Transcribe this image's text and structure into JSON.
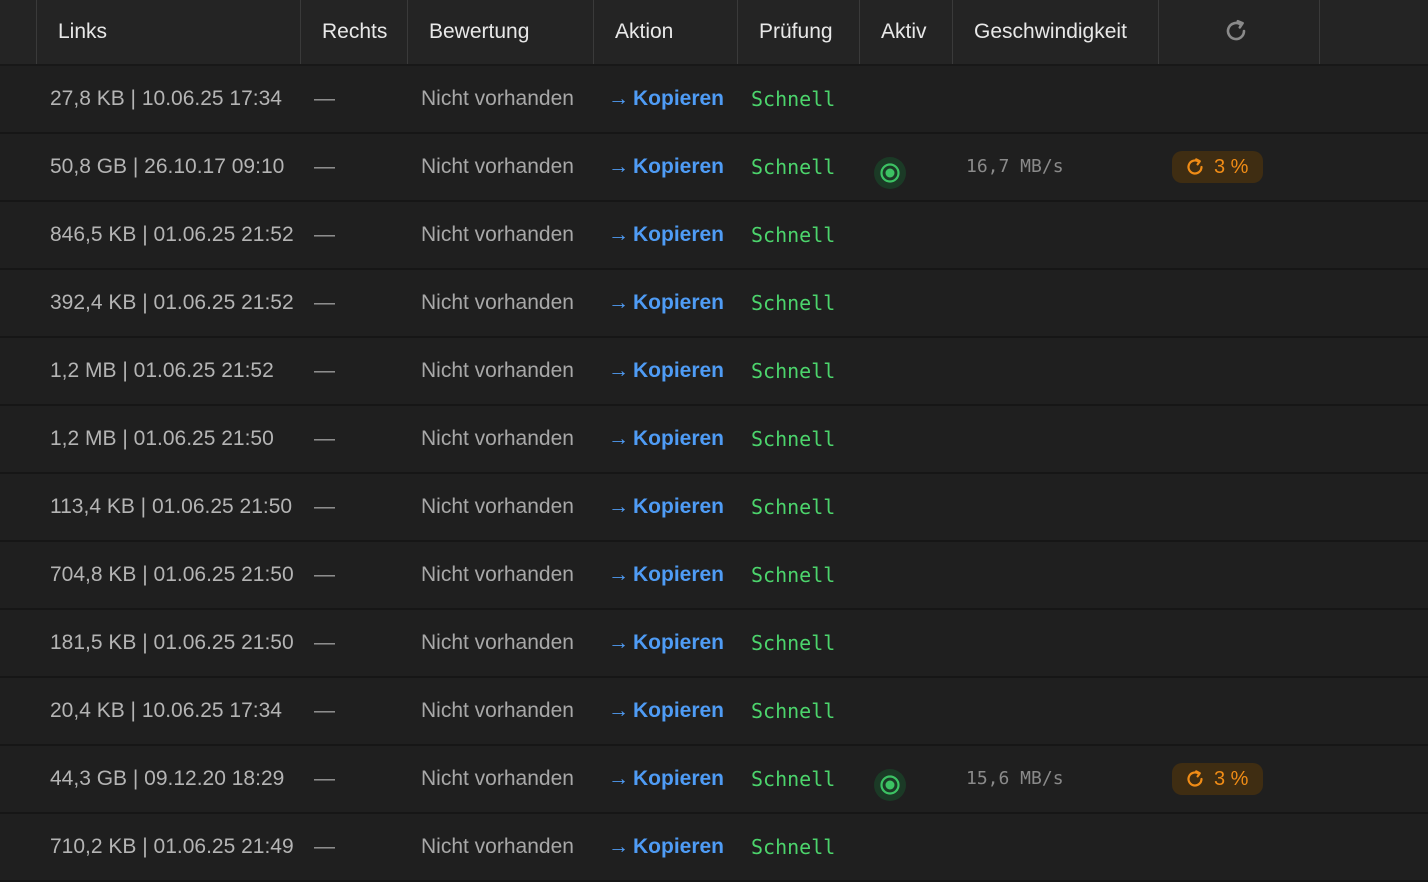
{
  "header": {
    "links": "Links",
    "rechts": "Rechts",
    "bewertung": "Bewertung",
    "aktion": "Aktion",
    "pruefung": "Prüfung",
    "aktiv": "Aktiv",
    "geschwindigkeit": "Geschwindigkeit",
    "refresh_icon": "refresh-icon"
  },
  "colors": {
    "background": "#1f1f1f",
    "header_background": "#242424",
    "action_blue": "#4f9cf5",
    "status_green": "#4cd46c",
    "badge_orange": "#f08c16",
    "badge_background": "#3f2d12"
  },
  "rows": [
    {
      "links": "27,8 KB | 10.06.25 17:34",
      "rechts": "—",
      "bewertung": "Nicht vorhanden",
      "aktion_arrow": "→",
      "aktion": "Kopieren",
      "pruefung": "Schnell",
      "active": false,
      "speed": "",
      "progress": ""
    },
    {
      "links": "50,8 GB | 26.10.17 09:10",
      "rechts": "—",
      "bewertung": "Nicht vorhanden",
      "aktion_arrow": "→",
      "aktion": "Kopieren",
      "pruefung": "Schnell",
      "active": true,
      "speed": "16,7 MB/s",
      "progress": "3 %"
    },
    {
      "links": "846,5 KB | 01.06.25 21:52",
      "rechts": "—",
      "bewertung": "Nicht vorhanden",
      "aktion_arrow": "→",
      "aktion": "Kopieren",
      "pruefung": "Schnell",
      "active": false,
      "speed": "",
      "progress": ""
    },
    {
      "links": "392,4 KB | 01.06.25 21:52",
      "rechts": "—",
      "bewertung": "Nicht vorhanden",
      "aktion_arrow": "→",
      "aktion": "Kopieren",
      "pruefung": "Schnell",
      "active": false,
      "speed": "",
      "progress": ""
    },
    {
      "links": "1,2 MB | 01.06.25 21:52",
      "rechts": "—",
      "bewertung": "Nicht vorhanden",
      "aktion_arrow": "→",
      "aktion": "Kopieren",
      "pruefung": "Schnell",
      "active": false,
      "speed": "",
      "progress": ""
    },
    {
      "links": "1,2 MB | 01.06.25 21:50",
      "rechts": "—",
      "bewertung": "Nicht vorhanden",
      "aktion_arrow": "→",
      "aktion": "Kopieren",
      "pruefung": "Schnell",
      "active": false,
      "speed": "",
      "progress": ""
    },
    {
      "links": "113,4 KB | 01.06.25 21:50",
      "rechts": "—",
      "bewertung": "Nicht vorhanden",
      "aktion_arrow": "→",
      "aktion": "Kopieren",
      "pruefung": "Schnell",
      "active": false,
      "speed": "",
      "progress": ""
    },
    {
      "links": "704,8 KB | 01.06.25 21:50",
      "rechts": "—",
      "bewertung": "Nicht vorhanden",
      "aktion_arrow": "→",
      "aktion": "Kopieren",
      "pruefung": "Schnell",
      "active": false,
      "speed": "",
      "progress": ""
    },
    {
      "links": "181,5 KB | 01.06.25 21:50",
      "rechts": "—",
      "bewertung": "Nicht vorhanden",
      "aktion_arrow": "→",
      "aktion": "Kopieren",
      "pruefung": "Schnell",
      "active": false,
      "speed": "",
      "progress": ""
    },
    {
      "links": "20,4 KB | 10.06.25 17:34",
      "rechts": "—",
      "bewertung": "Nicht vorhanden",
      "aktion_arrow": "→",
      "aktion": "Kopieren",
      "pruefung": "Schnell",
      "active": false,
      "speed": "",
      "progress": ""
    },
    {
      "links": "44,3 GB | 09.12.20 18:29",
      "rechts": "—",
      "bewertung": "Nicht vorhanden",
      "aktion_arrow": "→",
      "aktion": "Kopieren",
      "pruefung": "Schnell",
      "active": true,
      "speed": "15,6 MB/s",
      "progress": "3 %"
    },
    {
      "links": "710,2 KB | 01.06.25 21:49",
      "rechts": "—",
      "bewertung": "Nicht vorhanden",
      "aktion_arrow": "→",
      "aktion": "Kopieren",
      "pruefung": "Schnell",
      "active": false,
      "speed": "",
      "progress": ""
    }
  ]
}
